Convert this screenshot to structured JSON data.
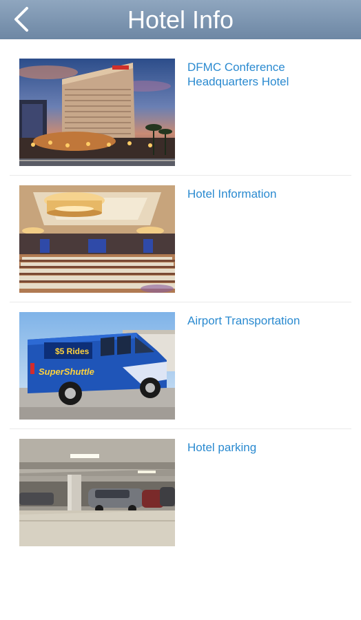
{
  "header": {
    "title": "Hotel Info",
    "back_icon": "chevron-left-icon"
  },
  "items": [
    {
      "label": "DFMC Conference Headquarters Hotel",
      "image": "hotel-exterior-night-photo"
    },
    {
      "label": "Hotel Information",
      "image": "ballroom-photo"
    },
    {
      "label": "Airport Transportation",
      "image": "shuttle-van-photo"
    },
    {
      "label": "Hotel parking",
      "image": "parking-garage-photo"
    }
  ],
  "van_text": {
    "brand": "SuperShuttle",
    "promo": "$5 Rides"
  },
  "colors": {
    "header_bg": "#7a93af",
    "link": "#2a8ad0",
    "divider": "#e9e9e9"
  }
}
